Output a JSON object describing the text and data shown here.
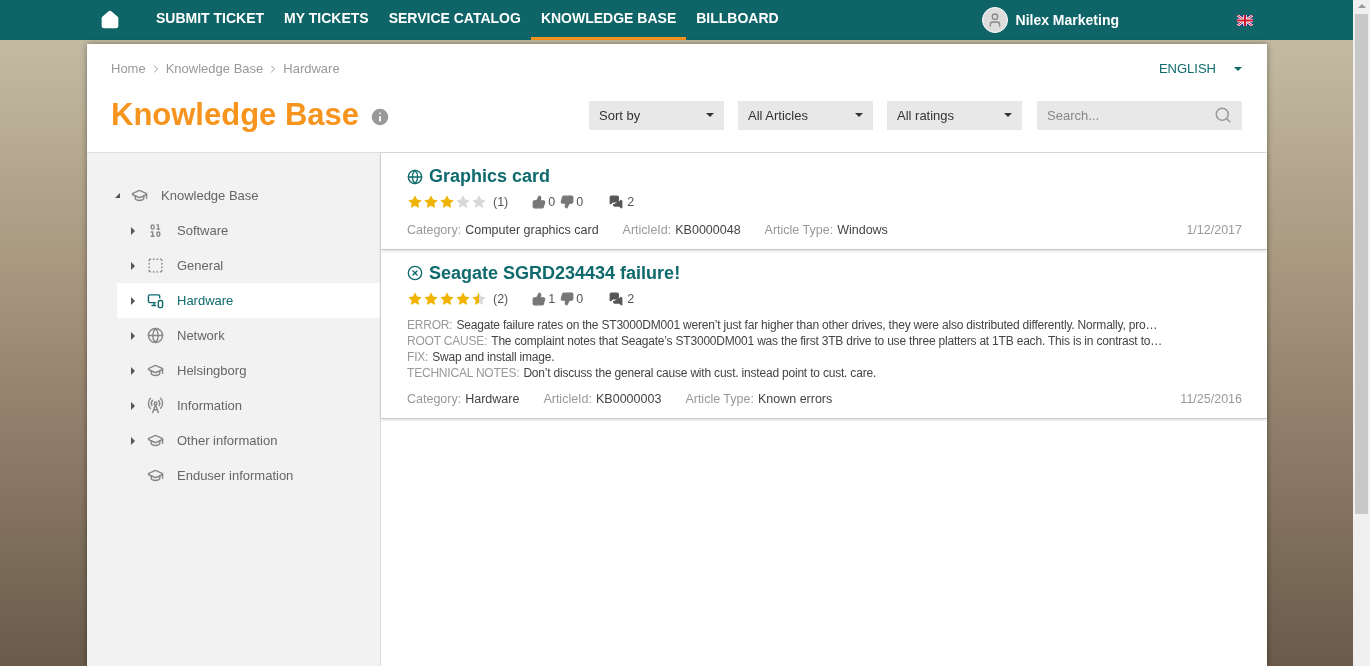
{
  "nav": {
    "items": [
      {
        "label": "SUBMIT TICKET",
        "selected": false
      },
      {
        "label": "MY TICKETS",
        "selected": false
      },
      {
        "label": "SERVICE CATALOG",
        "selected": false
      },
      {
        "label": "KNOWLEDGE BASE",
        "selected": true
      },
      {
        "label": "BILLBOARD",
        "selected": false
      }
    ],
    "user": "Nilex Marketing"
  },
  "breadcrumb": [
    "Home",
    "Knowledge Base",
    "Hardware"
  ],
  "language": "ENGLISH",
  "title": "Knowledge Base",
  "filters": [
    "Sort by",
    "All Articles",
    "All ratings"
  ],
  "search": {
    "placeholder": "Search..."
  },
  "tree": [
    {
      "label": "Knowledge Base",
      "kind": "cap",
      "expanded": true,
      "selected": false,
      "children": [
        {
          "label": "Software",
          "kind": "binary",
          "expanded": false,
          "selected": false
        },
        {
          "label": "General",
          "kind": "dashed",
          "expanded": false,
          "selected": false
        },
        {
          "label": "Hardware",
          "kind": "devices",
          "expanded": false,
          "selected": true
        },
        {
          "label": "Network",
          "kind": "globe",
          "expanded": false,
          "selected": false
        },
        {
          "label": "Helsingborg",
          "kind": "cap",
          "expanded": false,
          "selected": false
        },
        {
          "label": "Information",
          "kind": "antenna",
          "expanded": false,
          "selected": false
        },
        {
          "label": "Other information",
          "kind": "cap",
          "expanded": false,
          "selected": false
        },
        {
          "label": "Enduser information",
          "kind": "cap",
          "selected": false
        }
      ]
    }
  ],
  "articles": [
    {
      "kind": "globe",
      "title": "Graphics card",
      "stars": 3,
      "rating_count": "(1)",
      "likes": "0",
      "dislikes": "0",
      "comments": "2",
      "meta": [
        {
          "label": "Category:",
          "value": "Computer graphics card"
        },
        {
          "label": "ArticleId:",
          "value": "KB0000048"
        },
        {
          "label": "Article Type:",
          "value": "Windows"
        }
      ],
      "date": "1/12/2017"
    },
    {
      "kind": "error",
      "title": "Seagate SGRD234434 failure!",
      "stars": 4.5,
      "rating_count": "(2)",
      "likes": "1",
      "dislikes": "0",
      "comments": "2",
      "details": [
        {
          "label": "ERROR:",
          "value": "Seagate failure rates on the ST3000DM001 weren’t just far higher than other drives, they were also distributed differently. Normally, pro…"
        },
        {
          "label": "ROOT CAUSE:",
          "value": "The complaint notes that Seagate’s ST3000DM001 was the first 3TB drive to use three platters at 1TB each. This is in contrast to…"
        },
        {
          "label": "FIX:",
          "value": "Swap and install image."
        },
        {
          "label": "TECHNICAL NOTES:",
          "value": "Don’t discuss the general cause with cust. instead point to cust. care."
        }
      ],
      "meta": [
        {
          "label": "Category:",
          "value": "Hardware"
        },
        {
          "label": "ArticleId:",
          "value": "KB0000003"
        },
        {
          "label": "Article Type:",
          "value": "Known errors"
        }
      ],
      "date": "11/25/2016"
    }
  ]
}
